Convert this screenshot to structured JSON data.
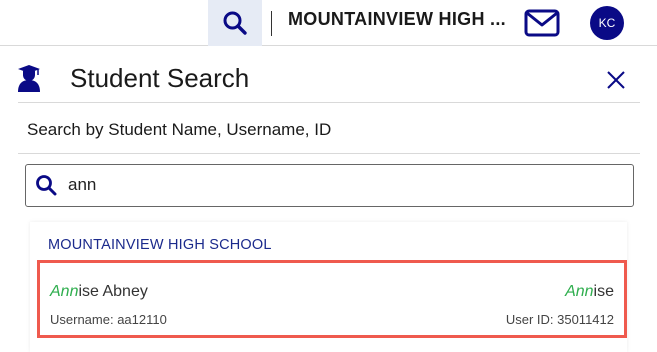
{
  "header": {
    "school_name": "MOUNTAINVIEW HIGH ...",
    "avatar_initials": "KC",
    "icons": [
      "search-icon",
      "mail-icon"
    ]
  },
  "panel": {
    "title": "Student Search",
    "search_label": "Search by Student Name, Username, ID",
    "icons": [
      "student-icon",
      "close-icon"
    ]
  },
  "search": {
    "value": "ann",
    "placeholder": ""
  },
  "results": {
    "group_title": "MOUNTAINVIEW HIGH SCHOOL",
    "items": [
      {
        "name_match": "Ann",
        "name_rest": "ise Abney",
        "nickname_match": "Ann",
        "nickname_rest": "ise",
        "username": "Username: aa12110",
        "user_id": "User ID: 35011412"
      }
    ]
  },
  "colors": {
    "accent": "#0a0a86",
    "match_highlight": "#2fae4e",
    "selection_border": "#ef5a4e",
    "group_header": "#1b2a8c"
  }
}
